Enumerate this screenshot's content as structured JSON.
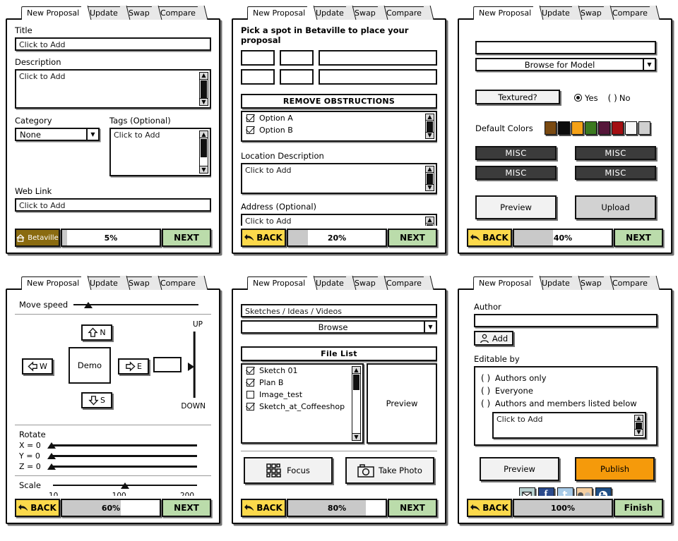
{
  "tabs": [
    "New Proposal",
    "Update",
    "Swap",
    "Compare"
  ],
  "common": {
    "click_to_add": "Click to Add",
    "back_label": "BACK",
    "next_label": "NEXT",
    "preview_label": "Preview"
  },
  "colors": {
    "back_button": "#fcd94b",
    "next_button": "#bbdcab",
    "betaville_button": "#8a6b10",
    "publish_button": "#f59a0b",
    "misc_button": "#3b3b3b",
    "progress_fill": "#c9c9c9"
  },
  "panel1": {
    "title_label": "Title",
    "title_value": "Click to Add",
    "description_label": "Description",
    "description_value": "Click to Add",
    "category_label": "Category",
    "category_value": "None",
    "tags_label": "Tags (Optional)",
    "tags_value": "Click to Add",
    "weblink_label": "Web Link",
    "weblink_value": "Click to Add",
    "home_label": "Betaville",
    "progress": "5%",
    "progress_fraction": 5,
    "next_label": "NEXT"
  },
  "panel2": {
    "heading": "Pick a spot in Betaville to place your proposal",
    "obstructions_header": "REMOVE OBSTRUCTIONS",
    "options": [
      {
        "label": "Option A",
        "checked": true
      },
      {
        "label": "Option B",
        "checked": true
      }
    ],
    "location_label": "Location Description",
    "location_value": "Click to Add",
    "address_label": "Address (Optional)",
    "address_value": "Click to Add",
    "back_label": "BACK",
    "progress": "20%",
    "progress_fraction": 20,
    "next_label": "NEXT"
  },
  "panel3": {
    "model_field_value": "",
    "browse_label": "Browse for Model",
    "textured_label": "Textured?",
    "yes_label": "Yes",
    "no_label": "No",
    "textured_selected": "Yes",
    "default_colors_label": "Default Colors",
    "swatches": [
      "#7a4a12",
      "#0c0c0c",
      "#f5a218",
      "#3c7a20",
      "#56163a",
      "#a30f12",
      "#f7f7f7",
      "#cfcfcf"
    ],
    "misc_buttons": [
      "MISC",
      "MISC",
      "MISC",
      "MISC"
    ],
    "preview_label": "Preview",
    "upload_label": "Upload",
    "back_label": "BACK",
    "progress": "40%",
    "progress_fraction": 40,
    "next_label": "NEXT"
  },
  "panel4": {
    "move_speed_label": "Move speed",
    "move_speed_value": 12,
    "north_label": "N",
    "south_label": "S",
    "east_label": "E",
    "west_label": "W",
    "center_label": "Demo",
    "up_label": "UP",
    "down_label": "DOWN",
    "elevation_value": 50,
    "rotate_label": "Rotate",
    "rotate_axes": [
      {
        "label": "X = 0",
        "value": 0
      },
      {
        "label": "Y = 0",
        "value": 0
      },
      {
        "label": "Z = 0",
        "value": 0
      }
    ],
    "scale_label": "Scale",
    "scale_value": 100,
    "scale_ticks": [
      "10",
      "100",
      "200"
    ],
    "back_label": "BACK",
    "progress": "60%",
    "progress_fraction": 60,
    "next_label": "NEXT"
  },
  "panel5": {
    "media_label": "Sketches / Ideas / Videos",
    "browse_label": "Browse",
    "file_list_header": "File List",
    "files": [
      {
        "name": "Sketch 01",
        "checked": true
      },
      {
        "name": "Plan B",
        "checked": true
      },
      {
        "name": "Image_test",
        "checked": false
      },
      {
        "name": "Sketch_at_Coffeeshop",
        "checked": true
      }
    ],
    "preview_label": "Preview",
    "focus_label": "Focus",
    "take_photo_label": "Take Photo",
    "back_label": "BACK",
    "progress": "80%",
    "progress_fraction": 80,
    "next_label": "NEXT"
  },
  "panel6": {
    "author_label": "Author",
    "author_value": "",
    "add_label": "Add",
    "editable_by_label": "Editable by",
    "editable_options": [
      {
        "label": "Authors only",
        "selected": false
      },
      {
        "label": "Everyone",
        "selected": false
      },
      {
        "label": "Authors and members listed below",
        "selected": false
      }
    ],
    "members_value": "Click to Add",
    "preview_label": "Preview",
    "publish_label": "Publish",
    "social_icons": [
      {
        "name": "email-icon",
        "color": "#b7d0cf"
      },
      {
        "name": "facebook-icon",
        "color": "#2b4a8b"
      },
      {
        "name": "twitter-icon",
        "color": "#a8cbe8"
      },
      {
        "name": "flickr-icon",
        "color": "#f6cfa0"
      },
      {
        "name": "blogger-icon",
        "color": "#1f4f86"
      }
    ],
    "back_label": "BACK",
    "progress": "100%",
    "progress_fraction": 100,
    "finish_label": "Finish"
  }
}
